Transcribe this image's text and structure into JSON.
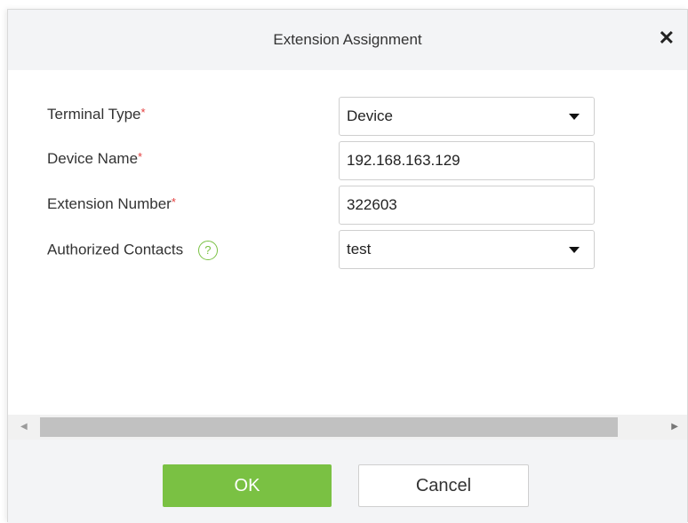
{
  "dialog": {
    "title": "Extension Assignment",
    "close_symbol": "✕"
  },
  "form": {
    "required_marker": "*",
    "terminal_type": {
      "label": "Terminal Type",
      "value": "Device"
    },
    "device_name": {
      "label": "Device Name",
      "value": "192.168.163.129"
    },
    "extension_number": {
      "label": "Extension Number",
      "value": "322603"
    },
    "authorized_contacts": {
      "label": "Authorized Contacts",
      "help_symbol": "?",
      "value": "test"
    }
  },
  "scrollbar": {
    "left_arrow": "◀",
    "right_arrow": "▶"
  },
  "footer": {
    "ok_label": "OK",
    "cancel_label": "Cancel"
  },
  "icons": {
    "close": "close-icon",
    "help": "help-circle-icon",
    "dropdown": "chevron-down-icon"
  },
  "colors": {
    "accent_green": "#7ac143",
    "required_red": "#e43e3e"
  }
}
